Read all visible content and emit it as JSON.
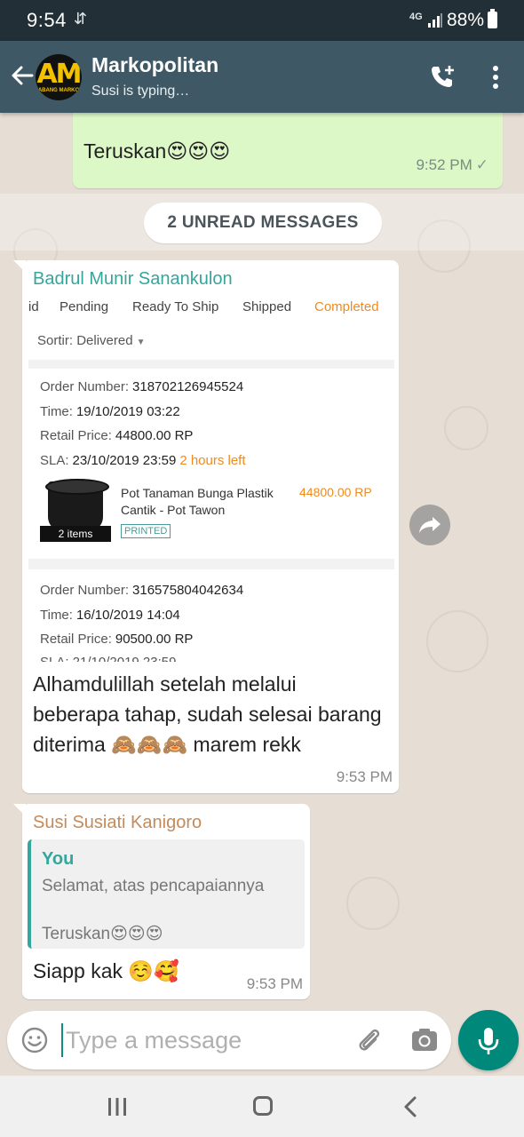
{
  "status_bar": {
    "time": "9:54",
    "usb_icon": "usb-icon",
    "network": "4G",
    "battery": "88%"
  },
  "header": {
    "contact_name": "Markopolitan",
    "status": "Susi is typing…",
    "avatar_logo_text": "ABANG MARKO",
    "icons": [
      "back-arrow-icon",
      "add-call-icon",
      "more-vert-icon"
    ]
  },
  "chat": {
    "outgoing": {
      "text": "Teruskan😍😍😍",
      "time": "9:52 PM",
      "status_icon": "check-icon"
    },
    "unread_banner": "2 UNREAD MESSAGES",
    "message1": {
      "sender": "Badrul Munir Sanankulon",
      "screenshot": {
        "tabs": [
          "id",
          "Pending",
          "Ready To Ship",
          "Shipped",
          "Completed"
        ],
        "active_tab": "Completed",
        "sort_label": "Sortir:",
        "sort_value": "Delivered",
        "order1": {
          "order_number_label": "Order Number:",
          "order_number": "318702126945524",
          "time_label": "Time:",
          "time": "19/10/2019 03:22",
          "price_label": "Retail Price:",
          "price": "44800.00 RP",
          "sla_label": "SLA:",
          "sla": "23/10/2019 23:59",
          "sla_note": "2 hours left",
          "product_name": "Pot Tanaman Bunga Plastik Cantik - Pot Tawon",
          "product_price": "44800.00 RP",
          "items": "2 items",
          "badge": "PRINTED"
        },
        "order2": {
          "order_number_label": "Order Number:",
          "order_number": "316575804042634",
          "time_label": "Time:",
          "time": "16/10/2019 14:04",
          "price_label": "Retail Price:",
          "price": "90500.00 RP",
          "sla_partial": "SLA: 21/10/2019 23:59"
        }
      },
      "caption": "Alhamdulillah setelah melalui beberapa tahap, sudah selesai barang diterima 🙈🙈🙈 marem rekk",
      "time": "9:53 PM"
    },
    "message2": {
      "sender": "Susi Susiati Kanigoro",
      "quote_author": "You",
      "quote_line1": "Selamat, atas pencapaiannya",
      "quote_line2": "Teruskan😍😍😍",
      "text": "Siapp kak ☺️🥰",
      "time": "9:53 PM"
    }
  },
  "composer": {
    "placeholder": "Type a message",
    "icons": [
      "emoji-icon",
      "attach-icon",
      "camera-icon",
      "mic-icon"
    ]
  },
  "colors": {
    "header": "#3e5965",
    "status_bar": "#232f36",
    "outgoing_bubble": "#dcf8c6",
    "accent": "#00897b",
    "sender1": "#35a69c",
    "sender2": "#c48a5a",
    "orange": "#f08a1c"
  }
}
